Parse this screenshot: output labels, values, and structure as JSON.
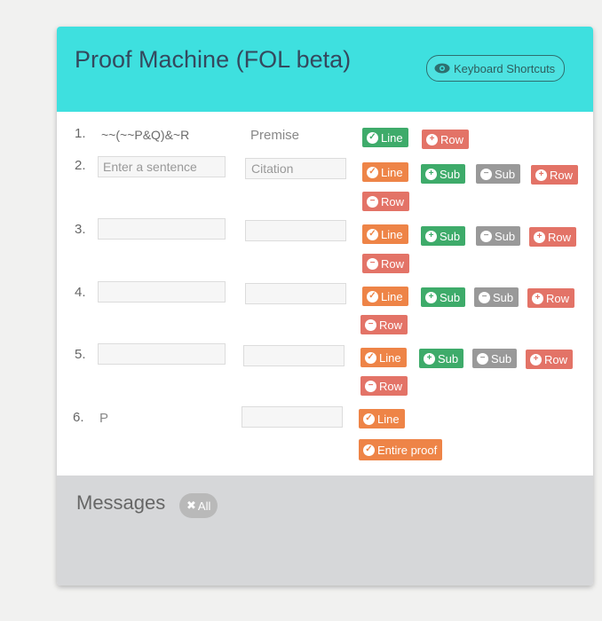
{
  "header": {
    "title": "Proof Machine (FOL beta)",
    "keyboard_shortcuts": "Keyboard Shortcuts"
  },
  "rows": [
    {
      "num": "1.",
      "sentence": "~~(~~P&Q)&~R",
      "citation": "Premise"
    },
    {
      "num": "2.",
      "sentence_placeholder": "Enter a sentence",
      "citation_placeholder": "Citation"
    },
    {
      "num": "3."
    },
    {
      "num": "4."
    },
    {
      "num": "5."
    },
    {
      "num": "6.",
      "sentence": "P"
    }
  ],
  "buttons": {
    "line": "Line",
    "row": "Row",
    "sub": "Sub",
    "entire_proof": "Entire proof"
  },
  "messages": {
    "title": "Messages",
    "clear_all": "All"
  },
  "colors": {
    "header_bg": "#3ee0df",
    "green": "#3eab6a",
    "orange": "#ee8447",
    "gray": "#999999",
    "red": "#e37367"
  }
}
